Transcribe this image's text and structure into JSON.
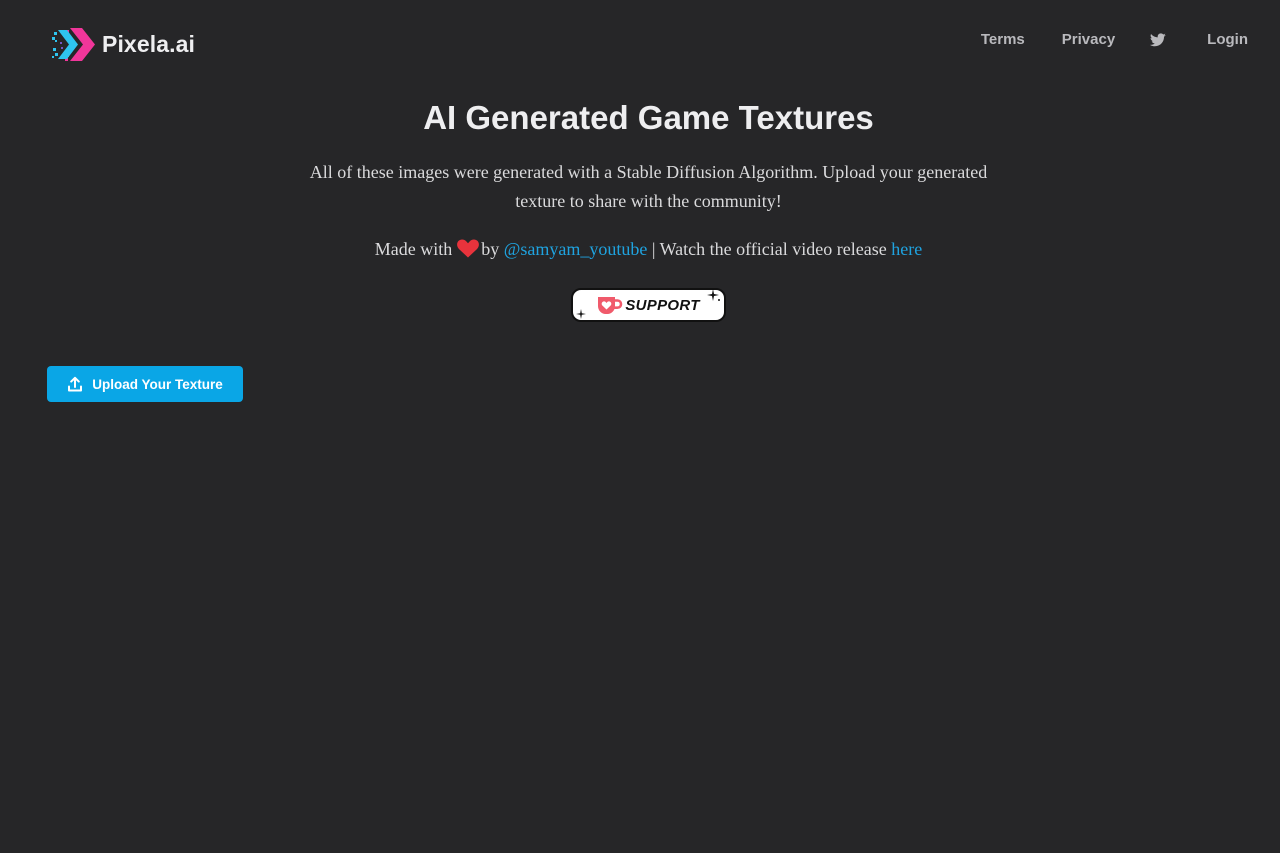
{
  "header": {
    "logo_text": "Pixela.ai",
    "nav": {
      "terms": "Terms",
      "privacy": "Privacy",
      "twitter_icon": "twitter-icon",
      "login": "Login"
    }
  },
  "hero": {
    "title": "AI Generated Game Textures",
    "description": "All of these images were generated with a Stable Diffusion Algorithm. Upload your generated texture to share with the community!",
    "made_with_prefix": "Made with",
    "heart_icon": "heart-icon",
    "by_text": "by",
    "author_handle": "@samyam_youtube",
    "watch_text": "| Watch the official video release",
    "video_link": "here"
  },
  "support": {
    "label": "SUPPORT",
    "icon": "coffee-cup-heart-icon"
  },
  "actions": {
    "upload_label": "Upload Your Texture",
    "upload_icon": "upload-icon"
  },
  "colors": {
    "background": "#262628",
    "accent": "#0aa6e6",
    "link": "#1fa3e0",
    "heart": "#e8333c",
    "logo_cyan": "#2ec4ef",
    "logo_pink": "#f0369a"
  }
}
